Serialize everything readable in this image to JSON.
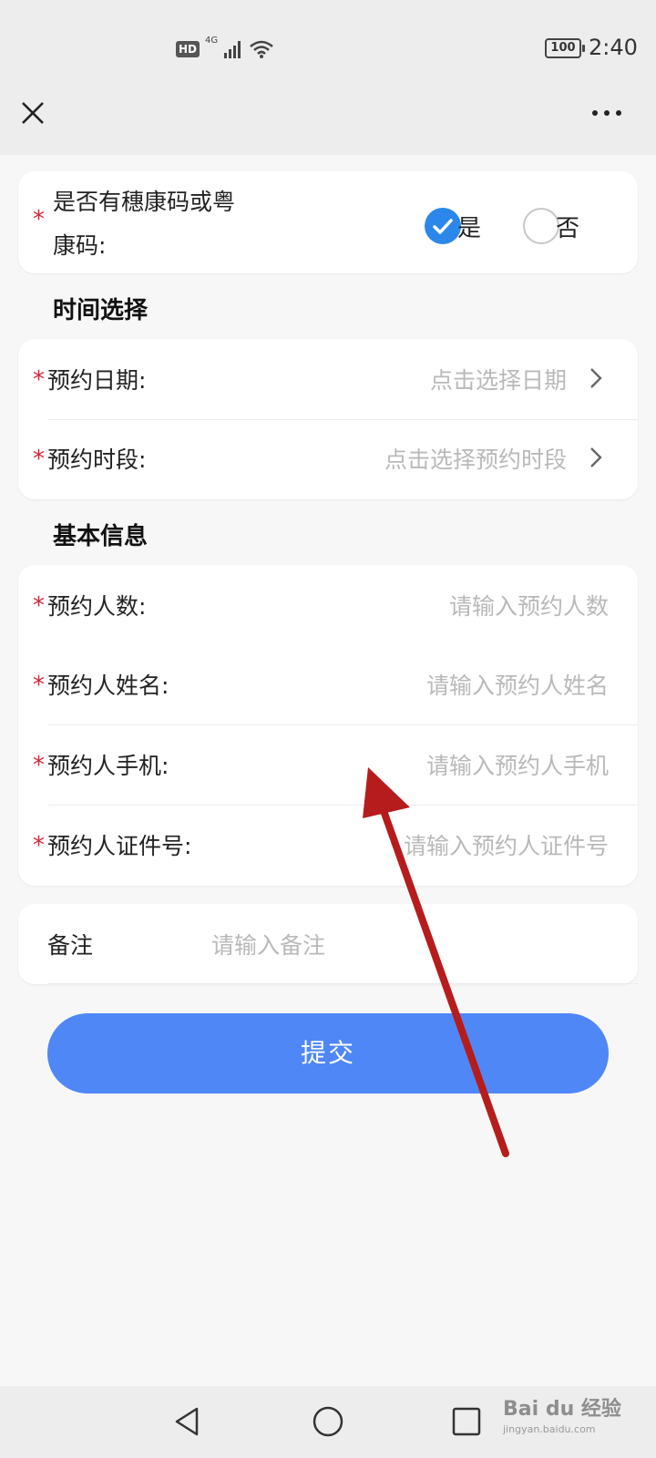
{
  "status_bar": {
    "hd_label": "HD",
    "network_label": "4G",
    "battery_level": "100",
    "time": "2:40",
    "icons": [
      "signal-icon",
      "wifi-icon",
      "battery-icon"
    ]
  },
  "app_bar": {
    "close_icon": "close-icon",
    "more_icon": "more-icon"
  },
  "health_code": {
    "question_line1": "是否有穗康码或粤",
    "question_line2": "康码:",
    "options": [
      {
        "label": "是",
        "checked": true
      },
      {
        "label": "否",
        "checked": false
      }
    ],
    "accent_color": "#2b88ea"
  },
  "time_section": {
    "title": "时间选择",
    "fields": [
      {
        "label": "预约日期:",
        "placeholder": "点击选择日期"
      },
      {
        "label": "预约时段:",
        "placeholder": "点击选择预约时段"
      }
    ]
  },
  "basic_section": {
    "title": "基本信息",
    "fields": [
      {
        "label": "预约人数:",
        "placeholder": "请输入预约人数"
      },
      {
        "label": "预约人姓名:",
        "placeholder": "请输入预约人姓名"
      },
      {
        "label": "预约人手机:",
        "placeholder": "请输入预约人手机"
      },
      {
        "label": "预约人证件号:",
        "placeholder": "请输入预约人证件号"
      }
    ]
  },
  "remarks": {
    "label": "备注",
    "placeholder": "请输入备注"
  },
  "submit": {
    "label": "提交",
    "color": "#4f87f7"
  },
  "required_mark": "*",
  "required_color": "#d3263a",
  "watermark": {
    "text": "Bai du 经验",
    "sub": "jingyan.baidu.com"
  },
  "nav_bar": {
    "icons": [
      "back-icon",
      "home-icon",
      "recents-icon"
    ]
  }
}
